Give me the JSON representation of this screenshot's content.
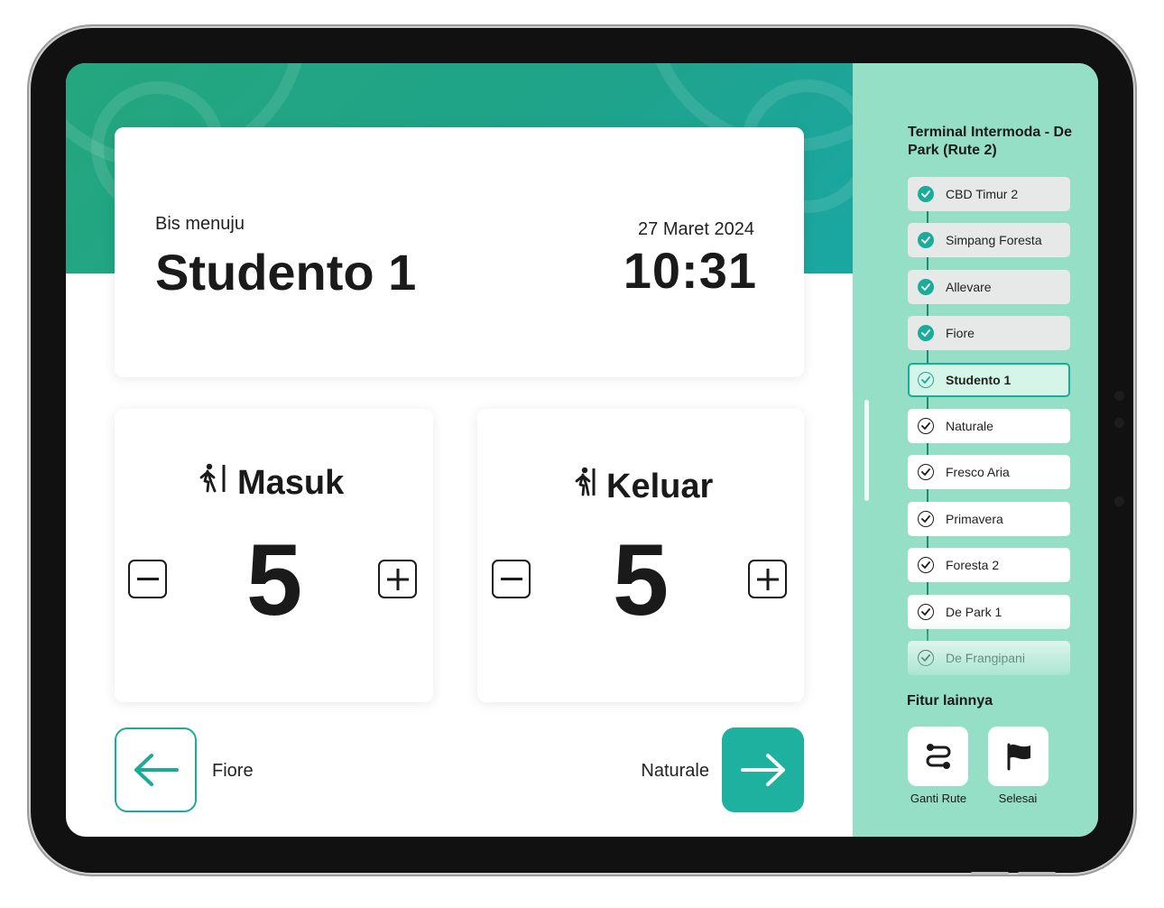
{
  "header": {
    "destination_label": "Bis menuju",
    "destination": "Studento 1",
    "date": "27 Maret 2024",
    "time": "10:31"
  },
  "counters": {
    "in": {
      "label": "Masuk",
      "value": "5",
      "icon": "person-enter-icon"
    },
    "out": {
      "label": "Keluar",
      "value": "5",
      "icon": "person-exit-icon"
    }
  },
  "navigation": {
    "prev_label": "Fiore",
    "next_label": "Naturale"
  },
  "sidebar": {
    "route_title": "Terminal Intermoda - De Park (Rute 2)",
    "stops": [
      {
        "label": "CBD Timur 2",
        "state": "done"
      },
      {
        "label": "Simpang Foresta",
        "state": "done"
      },
      {
        "label": "Allevare",
        "state": "done"
      },
      {
        "label": "Fiore",
        "state": "done"
      },
      {
        "label": "Studento 1",
        "state": "current"
      },
      {
        "label": "Naturale",
        "state": "todo"
      },
      {
        "label": "Fresco Aria",
        "state": "todo"
      },
      {
        "label": "Primavera",
        "state": "todo"
      },
      {
        "label": "Foresta 2",
        "state": "todo"
      },
      {
        "label": "De Park 1",
        "state": "todo"
      },
      {
        "label": "De Frangipani",
        "state": "todo"
      }
    ],
    "more_title": "Fitur lainnya",
    "features": [
      {
        "label": "Ganti Rute",
        "icon": "route-icon"
      },
      {
        "label": "Selesai",
        "icon": "flag-icon"
      }
    ]
  },
  "colors": {
    "accent": "#1aab9b",
    "header_green": "#24a77e",
    "sidebar_bg": "#95dfc6"
  }
}
